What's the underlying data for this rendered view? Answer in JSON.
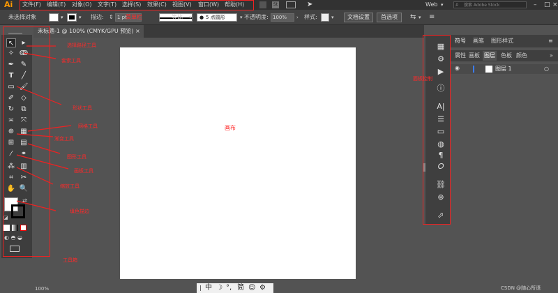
{
  "app": {
    "logo": "Ai",
    "workspace": "Web",
    "search_placeholder": "搜索 Adobe Stock"
  },
  "menu": [
    "文件(F)",
    "编辑(E)",
    "对象(O)",
    "文字(T)",
    "选择(S)",
    "效果(C)",
    "视图(V)",
    "窗口(W)",
    "帮助(H)"
  ],
  "options": {
    "no_selection": "未选择对象",
    "stroke_label": "描边:",
    "stroke_value": "1 pt",
    "uniform": "等比",
    "brush": "5 点圆形",
    "opacity_label": "不透明度:",
    "opacity_value": "100%",
    "style_label": "样式:",
    "doc_setup": "文档设置",
    "preferences": "首选项"
  },
  "document": {
    "tab_title": "未标题-1 @ 100% (CMYK/GPU 预览)",
    "close": "×",
    "zoom": "100%"
  },
  "panels": {
    "tabs_top": [
      "符号",
      "画笔",
      "图形样式"
    ],
    "tabs_bottom": [
      "属性",
      "画板",
      "图层",
      "色板",
      "颜色"
    ],
    "layer_name": "图层 1"
  },
  "annotations": {
    "menubar": "菜单栏",
    "select_tool": "选择路径工具",
    "lasso": "套索工具",
    "shape": "形状工具",
    "shape_builder": "网格工具",
    "gradient": "渐变工具",
    "eyedropper": "图形工具",
    "artboard_tool": "画板工具",
    "zoom_tool": "缩放工具",
    "fill_stroke": "填色描边",
    "toolbox": "工具箱",
    "canvas": "画布",
    "panel_control": "面板控制"
  },
  "status": {
    "ime": "中",
    "glyphs": "简"
  },
  "credit": "CSDN @随心所语",
  "colors": {
    "accent": "#ff9a00",
    "annotation": "#e22222",
    "bg": "#535353"
  }
}
